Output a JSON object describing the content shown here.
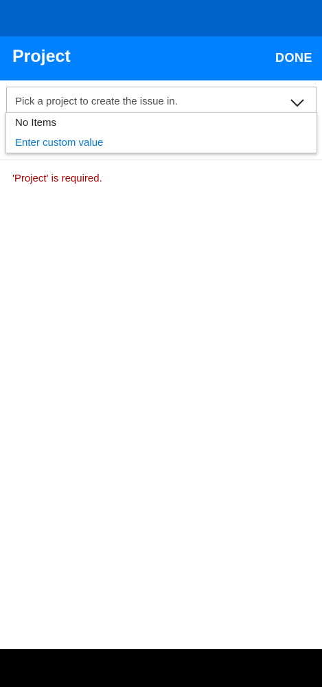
{
  "header": {
    "title": "Project",
    "done_label": "DONE"
  },
  "project_picker": {
    "placeholder": "Pick a project to create the issue in.",
    "dropdown": {
      "empty_label": "No Items",
      "custom_value_label": "Enter custom value"
    }
  },
  "validation": {
    "error": "'Project' is required."
  },
  "colors": {
    "status_bar": "#0063cb",
    "app_bar": "#0081ff",
    "link": "#0078d4",
    "error": "#a80000"
  },
  "icons": {
    "combo": "chevron-down-icon"
  }
}
